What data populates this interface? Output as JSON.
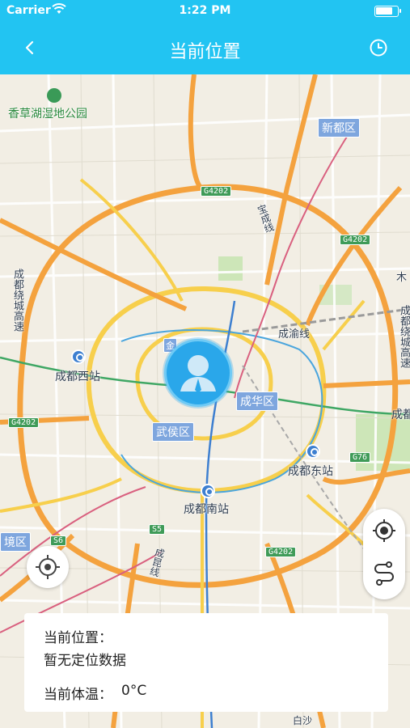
{
  "status_bar": {
    "carrier": "Carrier",
    "time": "1:22 PM"
  },
  "nav": {
    "title": "当前位置",
    "back_icon": "chevron-left-icon",
    "history_icon": "clock-icon"
  },
  "map": {
    "labels": {
      "park": "香草湖湿地公园",
      "xindu": "新都区",
      "chengdu_west": "成都西站",
      "chengdu_east": "成都东站",
      "chengdu_south": "成都南站",
      "chenghua": "成华区",
      "wuhou": "武侯区",
      "chengdu_ring_left": "成都绕城高速",
      "chengdu_ring_right": "成都绕城高速",
      "chengyu": "成渝线",
      "baocheng": "宝成线",
      "jin": "金",
      "chengdu_cut": "成都",
      "mu": "木",
      "jing_district": "境区",
      "chengkun": "成昆线",
      "baisha": "白沙",
      "road_g4202_1": "G4202",
      "road_g4202_2": "G4202",
      "road_g4202_3": "G4202",
      "road_g4202_4": "G4202",
      "road_g76": "G76",
      "road_s6": "S6",
      "road_s": "S",
      "road_s5": "S5"
    }
  },
  "info": {
    "location_label": "当前位置：",
    "location_value": "暂无定位数据",
    "temp_label": "当前体温：",
    "temp_value": "0°C"
  },
  "colors": {
    "accent": "#22c4f2",
    "marker": "#2aa7ea",
    "road_orange": "#f4a23e",
    "road_yellow": "#f7cf4c",
    "rail_pink": "#d9607f"
  }
}
